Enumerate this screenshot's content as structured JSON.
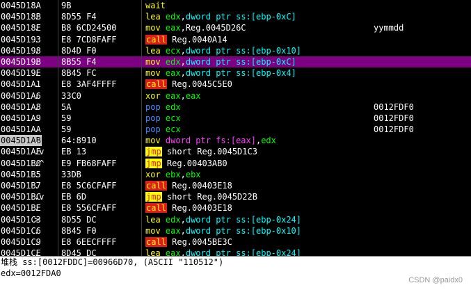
{
  "rows": [
    {
      "addr": "0045D18A",
      "mark": ".",
      "hex": "9B",
      "dis": [
        [
          "kw-mov",
          "wait"
        ]
      ],
      "cmt": ""
    },
    {
      "addr": "0045D18B",
      "mark": ".",
      "hex": "8D55 F4",
      "dis": [
        [
          "kw-lea",
          "lea"
        ],
        [
          "tok-plain",
          " "
        ],
        [
          "tok-reg",
          "edx"
        ],
        [
          "tok-plain",
          ","
        ],
        [
          "tok-mem",
          "dword ptr ss:[ebp-0xC]"
        ]
      ],
      "cmt": ""
    },
    {
      "addr": "0045D18E",
      "mark": ".",
      "hex": "B8 6CD24500",
      "dis": [
        [
          "kw-mov",
          "mov"
        ],
        [
          "tok-plain",
          " "
        ],
        [
          "tok-reg",
          "eax"
        ],
        [
          "tok-plain",
          ",Reg.0045D26C"
        ]
      ],
      "cmt": "yymmdd"
    },
    {
      "addr": "0045D193",
      "mark": ".",
      "hex": "E8 7CD8FAFF",
      "dis": [
        [
          "kw-call",
          "call"
        ],
        [
          "tok-plain",
          " Reg.0040A14"
        ]
      ],
      "cmt": ""
    },
    {
      "addr": "0045D198",
      "mark": ".",
      "hex": "8D4D F0",
      "dis": [
        [
          "kw-lea",
          "lea"
        ],
        [
          "tok-plain",
          " "
        ],
        [
          "tok-reg",
          "ecx"
        ],
        [
          "tok-plain",
          ","
        ],
        [
          "tok-mem",
          "dword ptr ss:[ebp-0x10]"
        ]
      ],
      "cmt": ""
    },
    {
      "addr": "0045D19B",
      "mark": ".",
      "hex": "8B55 F4",
      "dis": [
        [
          "kw-mov",
          "mov"
        ],
        [
          "tok-plain",
          " "
        ],
        [
          "tok-reg",
          "edx"
        ],
        [
          "tok-plain",
          ","
        ],
        [
          "tok-mem",
          "dword ptr ss:[ebp-0xC]"
        ]
      ],
      "cmt": "",
      "selected": true
    },
    {
      "addr": "0045D19E",
      "mark": ".",
      "hex": "8B45 FC",
      "dis": [
        [
          "kw-mov",
          "mov"
        ],
        [
          "tok-plain",
          " "
        ],
        [
          "tok-reg",
          "eax"
        ],
        [
          "tok-plain",
          ","
        ],
        [
          "tok-mem",
          "dword ptr ss:[ebp-0x4]"
        ]
      ],
      "cmt": ""
    },
    {
      "addr": "0045D1A1",
      "mark": ".",
      "hex": "E8 3AF4FFFF",
      "dis": [
        [
          "kw-call",
          "call"
        ],
        [
          "tok-plain",
          " Reg.0045C5E0"
        ]
      ],
      "cmt": ""
    },
    {
      "addr": "0045D1A6",
      "mark": ".",
      "hex": "33C0",
      "dis": [
        [
          "kw-xor",
          "xor"
        ],
        [
          "tok-plain",
          " "
        ],
        [
          "tok-reg",
          "eax"
        ],
        [
          "tok-plain",
          ","
        ],
        [
          "tok-reg",
          "eax"
        ]
      ],
      "cmt": ""
    },
    {
      "addr": "0045D1A8",
      "mark": ".",
      "hex": "5A",
      "dis": [
        [
          "kw-pop",
          "pop"
        ],
        [
          "tok-plain",
          " "
        ],
        [
          "tok-reg",
          "edx"
        ]
      ],
      "cmt": "0012FDF0"
    },
    {
      "addr": "0045D1A9",
      "mark": ".",
      "hex": "59",
      "dis": [
        [
          "kw-pop",
          "pop"
        ],
        [
          "tok-plain",
          " "
        ],
        [
          "tok-reg",
          "ecx"
        ]
      ],
      "cmt": "0012FDF0"
    },
    {
      "addr": "0045D1AA",
      "mark": ".",
      "hex": "59",
      "dis": [
        [
          "kw-pop",
          "pop"
        ],
        [
          "tok-plain",
          " "
        ],
        [
          "tok-reg",
          "ecx"
        ]
      ],
      "cmt": "0012FDF0"
    },
    {
      "addr": "0045D1AB",
      "mark": ".",
      "hex": "64:8910",
      "dis": [
        [
          "kw-mov",
          "mov"
        ],
        [
          "tok-plain",
          " "
        ],
        [
          "tok-fs",
          "dword ptr fs:[eax]"
        ],
        [
          "tok-plain",
          ","
        ],
        [
          "tok-reg",
          "edx"
        ]
      ],
      "cmt": "",
      "addr_highlight": true
    },
    {
      "addr": "0045D1AE",
      "mark": ".v",
      "hex": "EB 13",
      "dis": [
        [
          "kw-jmp",
          "jmp"
        ],
        [
          "tok-plain",
          " short Reg.0045D1C3"
        ]
      ],
      "cmt": ""
    },
    {
      "addr": "0045D1B0",
      "mark": ".^",
      "hex": "E9 FB68FAFF",
      "dis": [
        [
          "kw-jmp",
          "jmp"
        ],
        [
          "tok-plain",
          " Reg.00403AB0"
        ]
      ],
      "cmt": ""
    },
    {
      "addr": "0045D1B5",
      "mark": ".",
      "hex": "33DB",
      "dis": [
        [
          "kw-xor",
          "xor"
        ],
        [
          "tok-plain",
          " "
        ],
        [
          "tok-reg",
          "ebx"
        ],
        [
          "tok-plain",
          ","
        ],
        [
          "tok-reg",
          "ebx"
        ]
      ],
      "cmt": ""
    },
    {
      "addr": "0045D1B7",
      "mark": ".",
      "hex": "E8 5C6CFAFF",
      "dis": [
        [
          "kw-call",
          "call"
        ],
        [
          "tok-plain",
          " Reg.00403E18"
        ]
      ],
      "cmt": ""
    },
    {
      "addr": "0045D1BC",
      "mark": ".v",
      "hex": "EB 6D",
      "dis": [
        [
          "kw-jmp",
          "jmp"
        ],
        [
          "tok-plain",
          " short Reg.0045D22B"
        ]
      ],
      "cmt": ""
    },
    {
      "addr": "0045D1BE",
      "mark": ".",
      "hex": "E8 556CFAFF",
      "dis": [
        [
          "kw-call",
          "call"
        ],
        [
          "tok-plain",
          " Reg.00403E18"
        ]
      ],
      "cmt": ""
    },
    {
      "addr": "0045D1C3",
      "mark": ">",
      "hex": "8D55 DC",
      "dis": [
        [
          "kw-lea",
          "lea"
        ],
        [
          "tok-plain",
          " "
        ],
        [
          "tok-reg",
          "edx"
        ],
        [
          "tok-plain",
          ","
        ],
        [
          "tok-mem",
          "dword ptr ss:[ebp-0x24]"
        ]
      ],
      "cmt": ""
    },
    {
      "addr": "0045D1C6",
      "mark": ".",
      "hex": "8B45 F0",
      "dis": [
        [
          "kw-mov",
          "mov"
        ],
        [
          "tok-plain",
          " "
        ],
        [
          "tok-reg",
          "eax"
        ],
        [
          "tok-plain",
          ","
        ],
        [
          "tok-mem",
          "dword ptr ss:[ebp-0x10]"
        ]
      ],
      "cmt": ""
    },
    {
      "addr": "0045D1C9",
      "mark": ".",
      "hex": "E8 6EECFFFF",
      "dis": [
        [
          "kw-call",
          "call"
        ],
        [
          "tok-plain",
          " Reg.0045BE3C"
        ]
      ],
      "cmt": ""
    },
    {
      "addr": "0045D1CE",
      "mark": ".",
      "hex": "8D45 DC",
      "dis": [
        [
          "kw-lea",
          "lea"
        ],
        [
          "tok-plain",
          " "
        ],
        [
          "tok-reg",
          "eax"
        ],
        [
          "tok-plain",
          ","
        ],
        [
          "tok-mem",
          "dword ptr ss:[ebp-0x24]"
        ]
      ],
      "cmt": ""
    }
  ],
  "info": {
    "line1": "堆栈 ss:[0012FDDC]=00966D70, (ASCII \"110512\")",
    "line2": "edx=0012FDA0"
  },
  "watermark": "CSDN @paidx0",
  "colors": {
    "background": "#000000",
    "selected_row": "#7e0082",
    "call_bg": "#e11b1b",
    "jmp_bg": "#ffff00",
    "mnemonic": "#ffff00",
    "pop": "#4a8cff",
    "register": "#00ff00",
    "memory": "#00ffff"
  }
}
